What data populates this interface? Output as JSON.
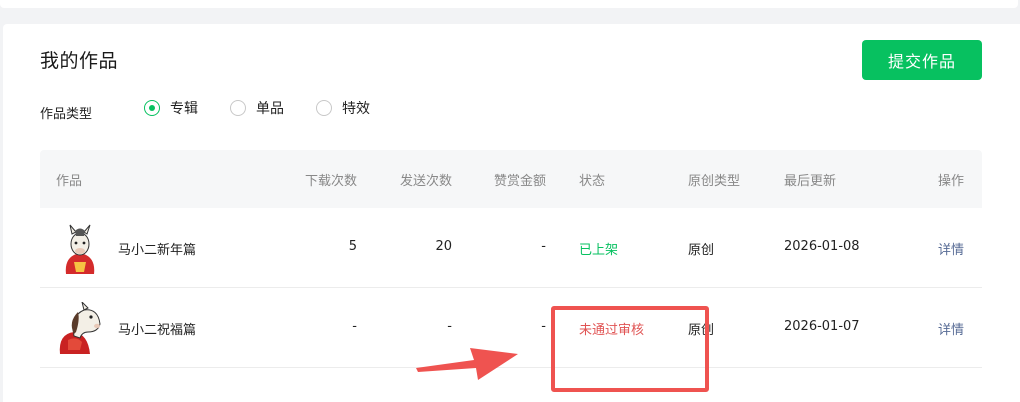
{
  "header": {
    "title": "我的作品",
    "submit_label": "提交作品"
  },
  "filter": {
    "label": "作品类型",
    "options": [
      {
        "label": "专辑",
        "checked": true
      },
      {
        "label": "单品",
        "checked": false
      },
      {
        "label": "特效",
        "checked": false
      }
    ]
  },
  "table": {
    "columns": [
      "作品",
      "下载次数",
      "发送次数",
      "赞赏金额",
      "状态",
      "原创类型",
      "最后更新",
      "操作"
    ],
    "rows": [
      {
        "name": "马小二新年篇",
        "downloads": "5",
        "sends": "20",
        "tips": "-",
        "status": "已上架",
        "original": "原创",
        "updated": "2026-01-08",
        "action": "详情"
      },
      {
        "name": "马小二祝福篇",
        "downloads": "-",
        "sends": "-",
        "tips": "-",
        "status": "未通过审核",
        "original": "原创",
        "updated": "2026-01-07",
        "action": "详情"
      }
    ]
  },
  "colors": {
    "accent": "#07c160",
    "error": "#e05353",
    "link": "#576b95",
    "annotation": "#ef5350"
  }
}
